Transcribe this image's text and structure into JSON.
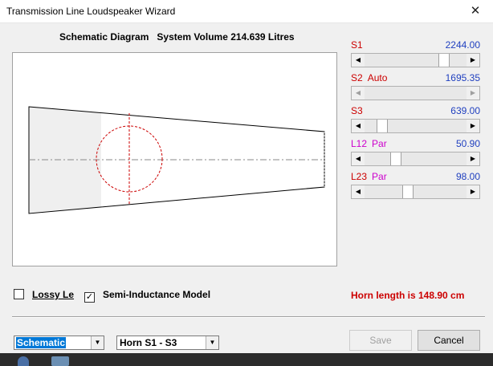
{
  "window": {
    "title": "Transmission Line Loudspeaker Wizard",
    "close_glyph": "✕"
  },
  "heading": {
    "label": "Schematic Diagram",
    "volume": "System Volume 214.639 Litres"
  },
  "sliders": [
    {
      "name": "S1",
      "mode": "",
      "value": "2244.00",
      "enabled": true,
      "thumb_fraction": 0.6
    },
    {
      "name": "S2",
      "mode": "Auto",
      "value": "1695.35",
      "enabled": false,
      "thumb_fraction": 0.0
    },
    {
      "name": "S3",
      "mode": "",
      "value": "639.00",
      "enabled": true,
      "thumb_fraction": 0.15
    },
    {
      "name": "L12",
      "mode": "Par",
      "value": "50.90",
      "enabled": true,
      "thumb_fraction": 0.3
    },
    {
      "name": "L23",
      "mode": "Par",
      "value": "98.00",
      "enabled": true,
      "thumb_fraction": 0.42
    }
  ],
  "options": {
    "lossy_le": {
      "label": "Lossy Le",
      "checked": false,
      "mnemonic": "L"
    },
    "semi_inductance": {
      "label": "Semi-Inductance Model",
      "checked": true,
      "mnemonic": "S"
    }
  },
  "horn_length_text": "Horn length is 148.90 cm",
  "view_select": {
    "value": "Schematic"
  },
  "section_select": {
    "value": "Horn S1 - S3"
  },
  "buttons": {
    "save": "Save",
    "cancel": "Cancel"
  },
  "colors": {
    "red": "#cc0000",
    "magenta": "#cc00cc",
    "blue": "#1f3fbf",
    "fill": "#efefef"
  },
  "icons": {
    "close": "close-icon",
    "dropdown": "chevron-down-icon",
    "scroll_left": "arrow-left-icon",
    "scroll_right": "arrow-right-icon"
  }
}
